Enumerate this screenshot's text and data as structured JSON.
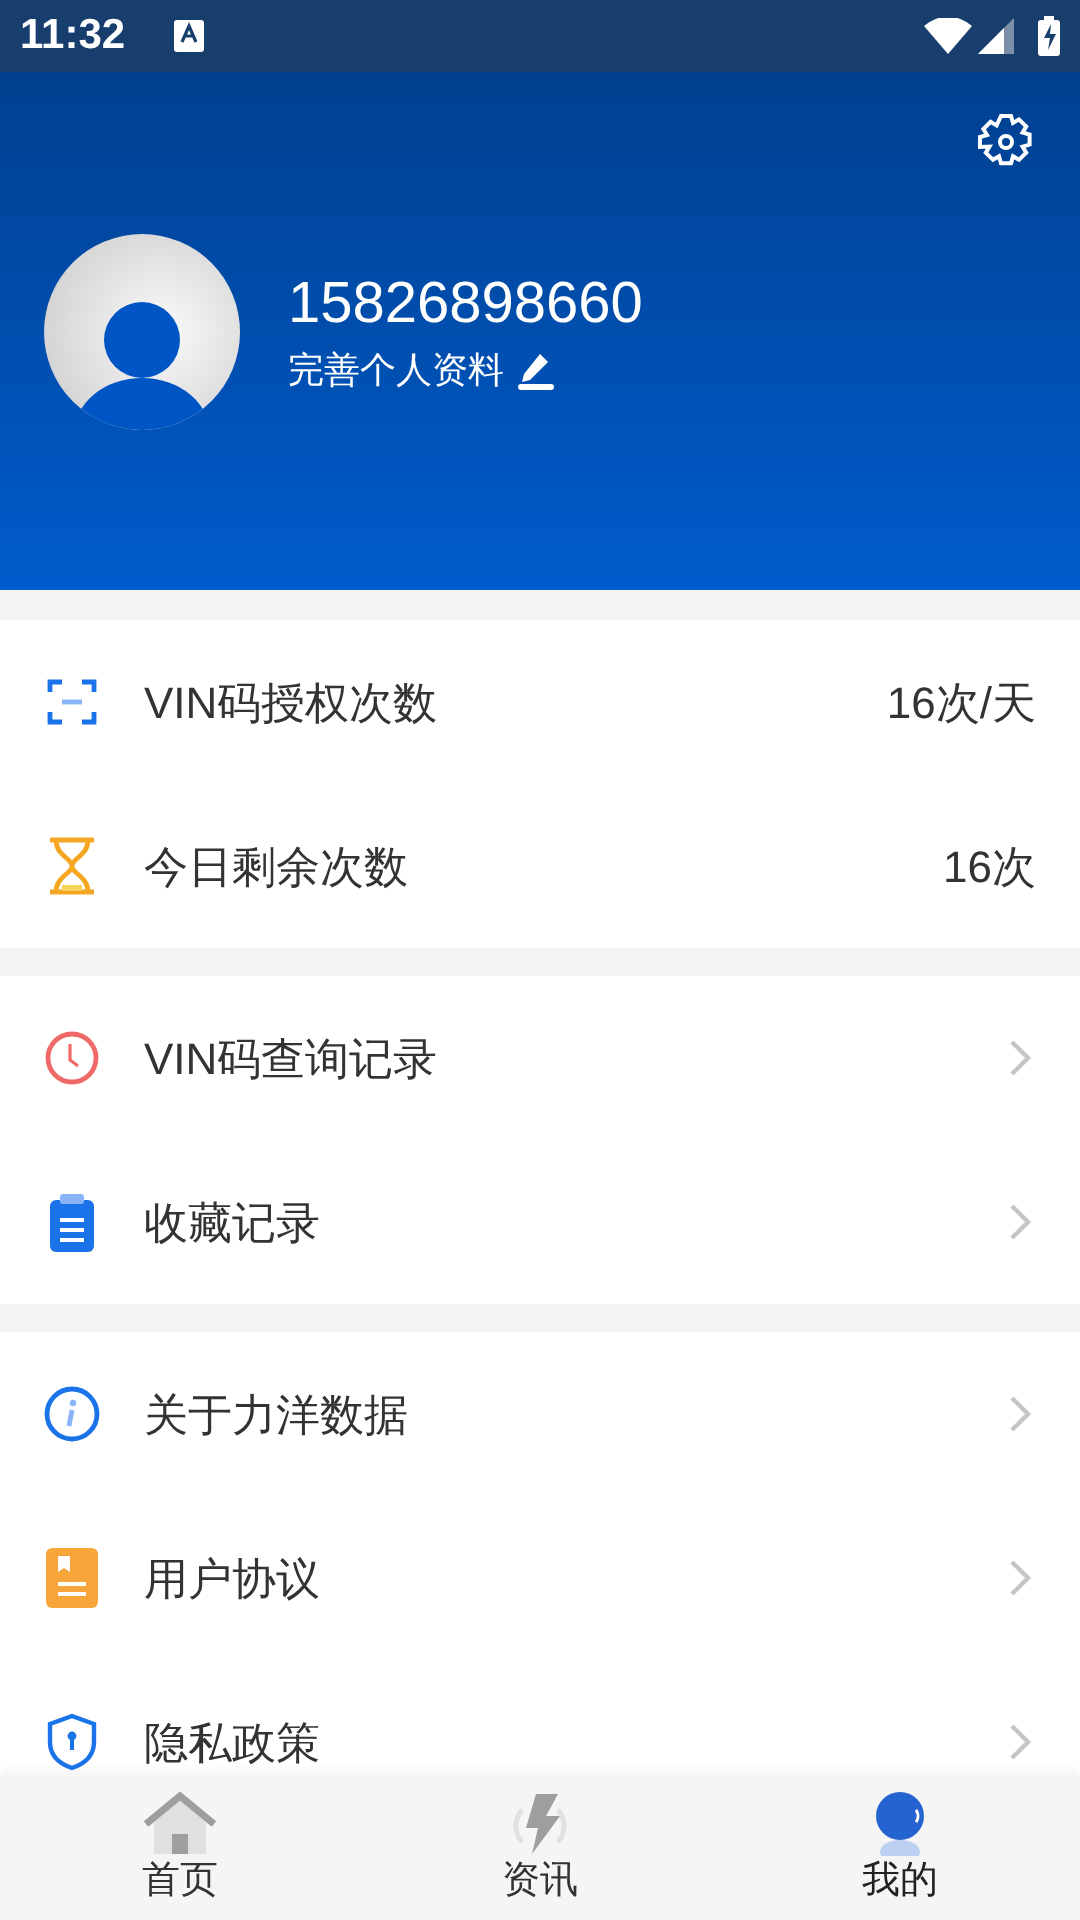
{
  "status_bar": {
    "time": "11:32"
  },
  "profile": {
    "phone": "15826898660",
    "edit_label": "完善个人资料"
  },
  "sections": [
    {
      "rows": [
        {
          "kind": "value",
          "label": "VIN码授权次数",
          "value": "16次/天"
        },
        {
          "kind": "value",
          "label": "今日剩余次数",
          "value": "16次"
        }
      ]
    },
    {
      "rows": [
        {
          "kind": "link",
          "label": "VIN码查询记录"
        },
        {
          "kind": "link",
          "label": "收藏记录"
        }
      ]
    },
    {
      "rows": [
        {
          "kind": "link",
          "label": "关于力洋数据"
        },
        {
          "kind": "link",
          "label": "用户协议"
        },
        {
          "kind": "link",
          "label": "隐私政策"
        }
      ]
    }
  ],
  "bottom_nav": [
    {
      "label": "首页",
      "selected": false
    },
    {
      "label": "资讯",
      "selected": false
    },
    {
      "label": "我的",
      "selected": true
    }
  ]
}
